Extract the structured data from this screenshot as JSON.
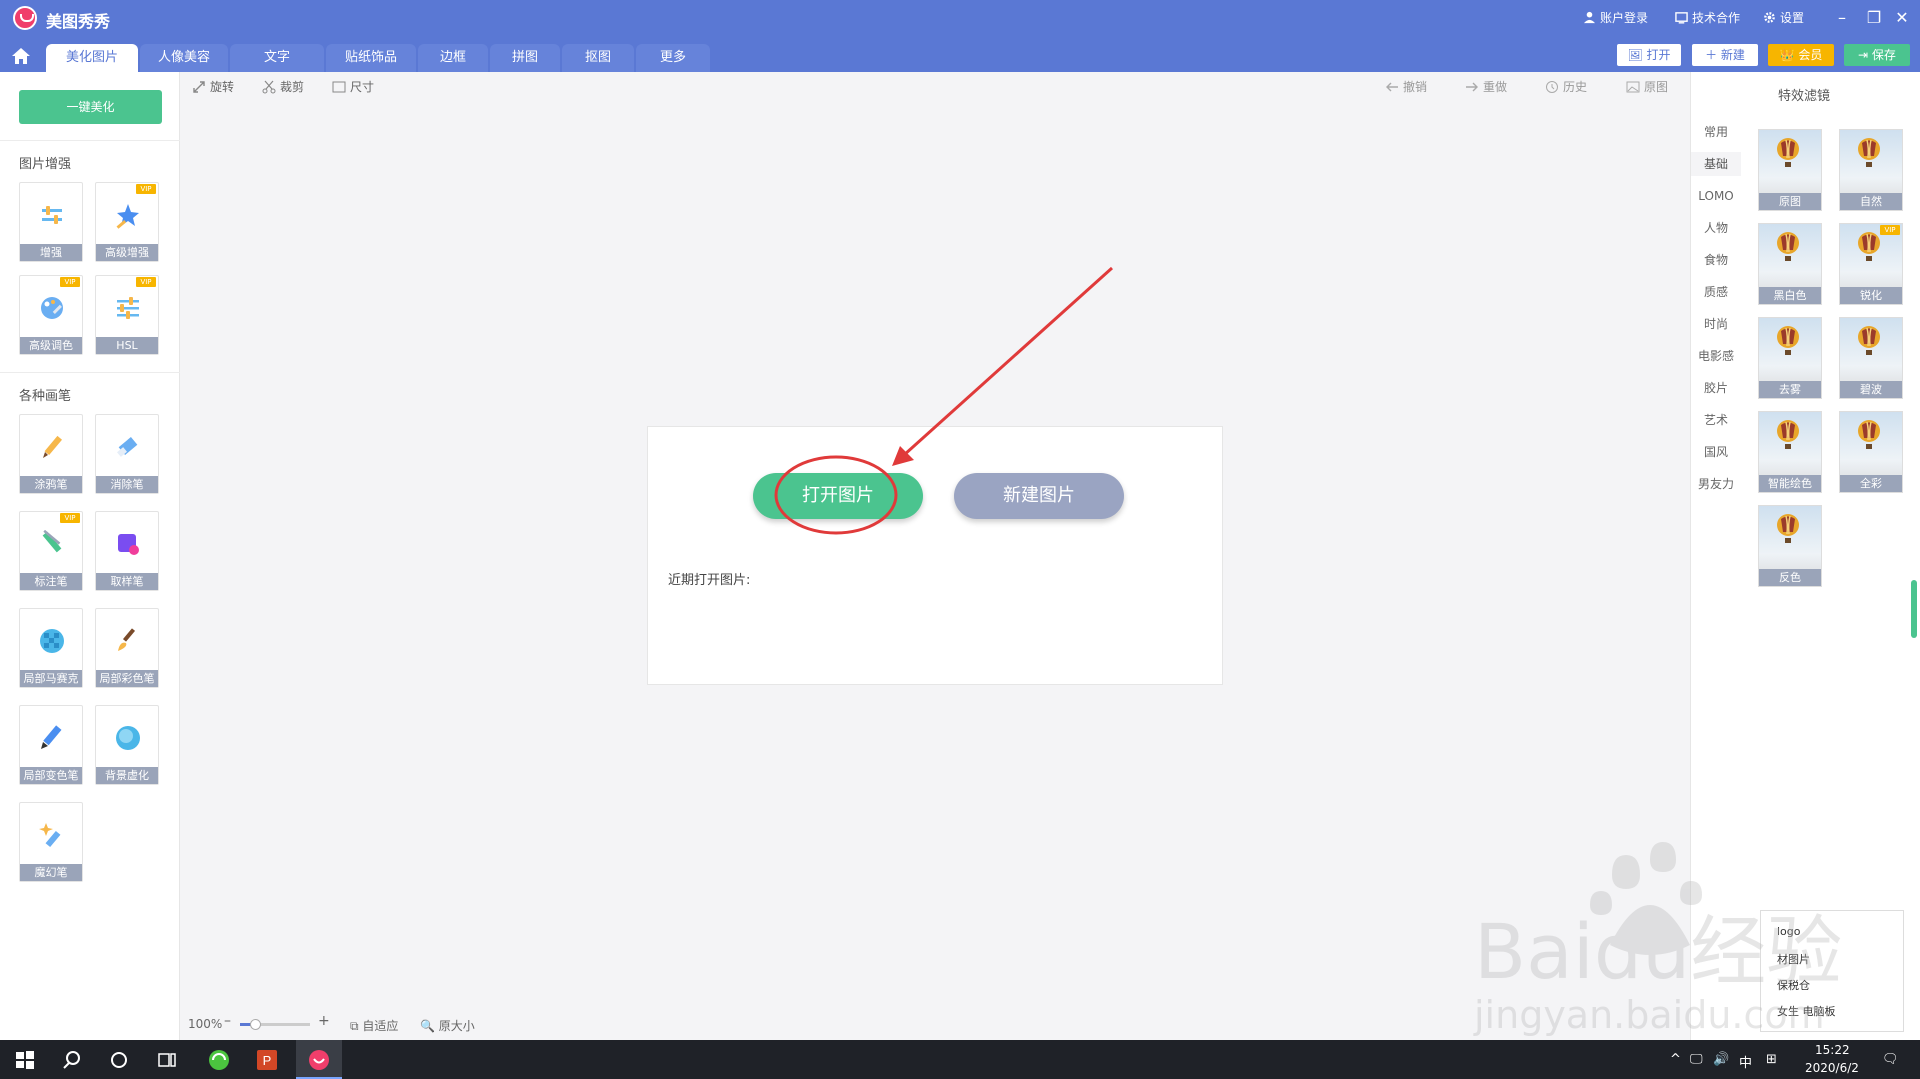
{
  "app": {
    "title": "美图秀秀"
  },
  "titlebar": {
    "account": "账户登录",
    "tech": "技术合作",
    "settings": "设置"
  },
  "tabs": [
    "美化图片",
    "人像美容",
    "文字",
    "贴纸饰品",
    "边框",
    "拼图",
    "抠图",
    "更多"
  ],
  "actions": {
    "open": "打开",
    "new": "新建",
    "member": "会员",
    "save": "保存"
  },
  "left": {
    "one_click": "一键美化",
    "section1": "图片增强",
    "section2": "各种画笔",
    "tools1": [
      {
        "label": "增强",
        "vip": ""
      },
      {
        "label": "高级增强",
        "vip": "VIP"
      },
      {
        "label": "高级调色",
        "vip": "VIP"
      },
      {
        "label": "HSL",
        "vip": "VIP"
      }
    ],
    "tools2": [
      {
        "label": "涂鸦笔",
        "vip": ""
      },
      {
        "label": "消除笔",
        "vip": ""
      },
      {
        "label": "标注笔",
        "vip": "VIP"
      },
      {
        "label": "取样笔",
        "vip": ""
      },
      {
        "label": "局部马赛克",
        "vip": ""
      },
      {
        "label": "局部彩色笔",
        "vip": ""
      },
      {
        "label": "局部变色笔",
        "vip": ""
      },
      {
        "label": "背景虚化",
        "vip": ""
      },
      {
        "label": "魔幻笔",
        "vip": ""
      }
    ]
  },
  "toolbar": {
    "rotate": "旋转",
    "crop": "裁剪",
    "size": "尺寸",
    "undo": "撤销",
    "redo": "重做",
    "history": "历史",
    "original": "原图"
  },
  "card": {
    "open": "打开图片",
    "new": "新建图片",
    "recent": "近期打开图片:"
  },
  "right": {
    "title": "特效滤镜",
    "categories": [
      "常用",
      "基础",
      "LOMO",
      "人物",
      "食物",
      "质感",
      "时尚",
      "电影感",
      "胶片",
      "艺术",
      "国风",
      "男友力"
    ],
    "filters": [
      {
        "label": "原图",
        "vip": ""
      },
      {
        "label": "自然",
        "vip": ""
      },
      {
        "label": "黑白色",
        "vip": ""
      },
      {
        "label": "锐化",
        "vip": "VIP"
      },
      {
        "label": "去雾",
        "vip": ""
      },
      {
        "label": "碧波",
        "vip": ""
      },
      {
        "label": "智能绘色",
        "vip": ""
      },
      {
        "label": "全彩",
        "vip": ""
      },
      {
        "label": "反色",
        "vip": ""
      }
    ]
  },
  "status": {
    "zoom": "100%",
    "zoom_fraction": 0.22,
    "fit": "自适应",
    "actual": "原大小"
  },
  "ad": {
    "items": [
      "logo",
      "材图片",
      "保税仓",
      "女生 电脑板"
    ]
  },
  "watermark": {
    "main": "Baidu经验",
    "sub": "jingyan.baidu.com"
  },
  "taskbar": {
    "time": "15:22",
    "date": "2020/6/2",
    "ime": "中"
  }
}
